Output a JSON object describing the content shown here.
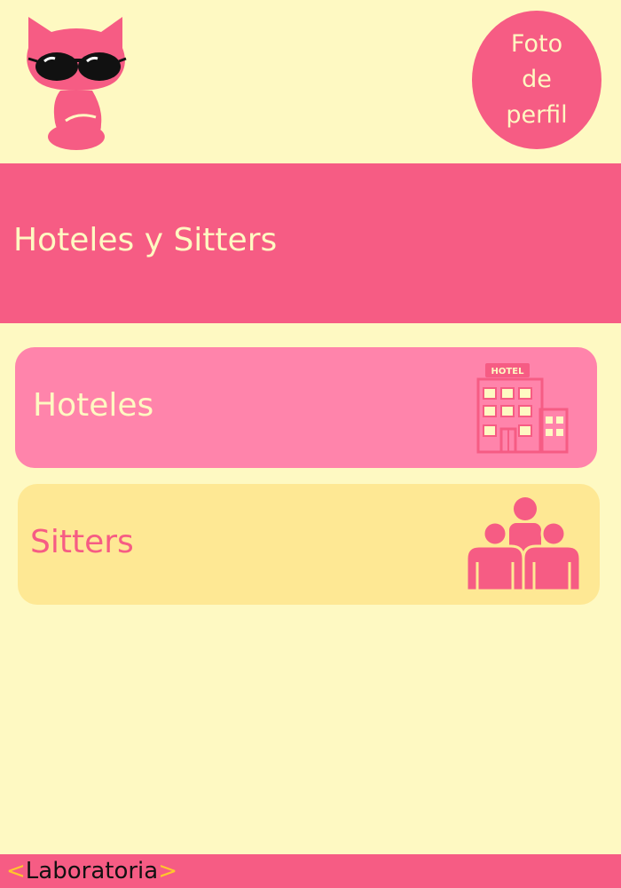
{
  "header": {
    "logo_icon": "cat-with-sunglasses-icon",
    "profile_label": "Foto\nde\nperfil"
  },
  "banner": {
    "title": "Hoteles y Sitters"
  },
  "menu": {
    "items": [
      {
        "label": "Hoteles",
        "icon": "hotel-building-icon",
        "icon_text": "HOTEL"
      },
      {
        "label": "Sitters",
        "icon": "people-group-icon"
      }
    ]
  },
  "footer": {
    "brand_open": "<",
    "brand": "Laboratoria",
    "brand_close": ">"
  },
  "colors": {
    "background": "#FEF9C2",
    "primary": "#F65C84",
    "hotel_card": "#FF84AB",
    "sitter_card": "#FEE894",
    "accent": "#FFC72C"
  }
}
